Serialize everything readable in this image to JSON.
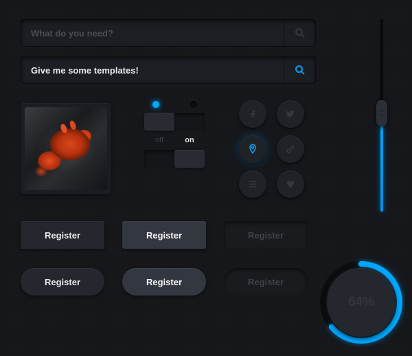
{
  "accent": "#00a8ff",
  "search1": {
    "placeholder": "What do you need?"
  },
  "search2": {
    "value": "Give me some templates!"
  },
  "toggle": {
    "off_label": "off",
    "on_label": "on"
  },
  "buttons": {
    "rect_normal": "Register",
    "rect_hover": "Register",
    "rect_disabled": "Register",
    "pill_normal": "Register",
    "pill_hover": "Register",
    "pill_disabled": "Register"
  },
  "progress": {
    "percent": 64,
    "label": "64%"
  },
  "social_icons": [
    "facebook",
    "twitter",
    "location-pin",
    "link",
    "list",
    "heart"
  ]
}
